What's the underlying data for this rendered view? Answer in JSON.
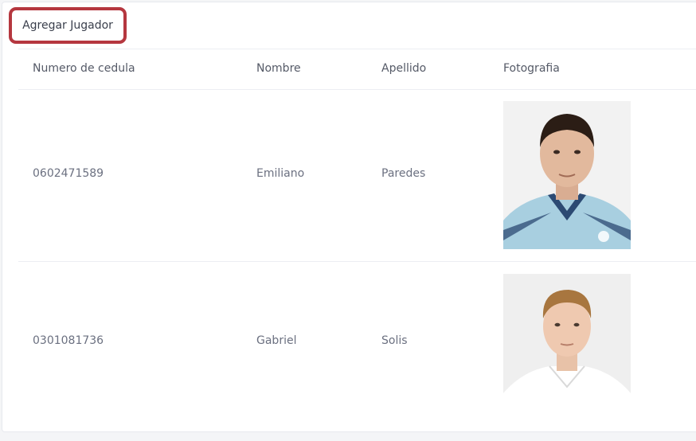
{
  "toolbar": {
    "add_label": "Agregar Jugador"
  },
  "table": {
    "headers": [
      "Numero de cedula",
      "Nombre",
      "Apellido",
      "Fotografia"
    ],
    "rows": [
      {
        "cedula": "0602471589",
        "nombre": "Emiliano",
        "apellido": "Paredes",
        "photo": "player-photo-goalkeeper"
      },
      {
        "cedula": "0301081736",
        "nombre": "Gabriel",
        "apellido": "Solis",
        "photo": "player-photo-white-kit"
      }
    ]
  },
  "colors": {
    "highlight_border": "#b5373f",
    "text": "#6b7080",
    "divider": "#eceef2"
  }
}
